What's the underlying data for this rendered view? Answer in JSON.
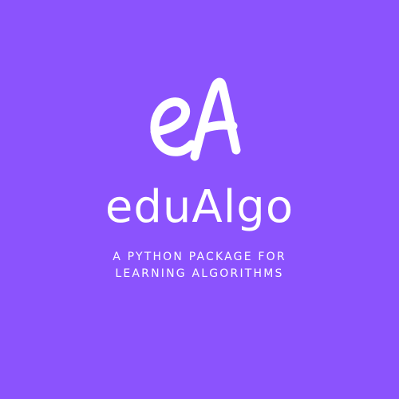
{
  "logo": {
    "monogram": "eA",
    "wordmark": "eduAlgo",
    "tagline_line1": "A PYTHON PACKAGE FOR",
    "tagline_line2": "LEARNING ALGORITHMS"
  },
  "colors": {
    "background": "#8b53fd",
    "foreground": "#ffffff"
  }
}
